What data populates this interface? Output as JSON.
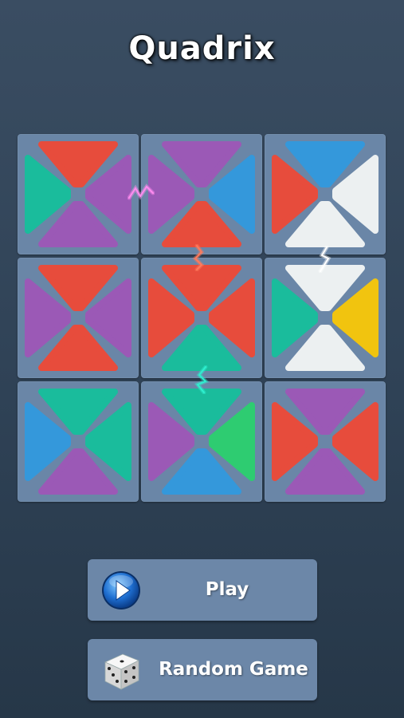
{
  "title": "Quadrix",
  "colors": {
    "red": "#e74c3c",
    "purple": "#9b59b6",
    "blue": "#3498db",
    "green": "#1abc9c",
    "lime": "#2ecc71",
    "white": "#ecf0f1",
    "yellow": "#f1c40f",
    "tile_bg": "#6a86a7"
  },
  "board": {
    "rows": 3,
    "cols": 3,
    "tiles": [
      {
        "top": "red",
        "right": "purple",
        "bottom": "purple",
        "left": "green"
      },
      {
        "top": "purple",
        "right": "blue",
        "bottom": "red",
        "left": "purple"
      },
      {
        "top": "blue",
        "right": "white",
        "bottom": "white",
        "left": "red"
      },
      {
        "top": "red",
        "right": "purple",
        "bottom": "red",
        "left": "purple"
      },
      {
        "top": "red",
        "right": "red",
        "bottom": "green",
        "left": "red"
      },
      {
        "top": "white",
        "right": "yellow",
        "bottom": "white",
        "left": "green"
      },
      {
        "top": "green",
        "right": "green",
        "bottom": "purple",
        "left": "blue"
      },
      {
        "top": "green",
        "right": "lime",
        "bottom": "blue",
        "left": "purple"
      },
      {
        "top": "purple",
        "right": "red",
        "bottom": "purple",
        "left": "red"
      }
    ],
    "sparks": [
      {
        "between": "tile-0-0|tile-0-1",
        "color": "#ff8cf0",
        "icon": "lightning-spark"
      },
      {
        "between": "tile-0-1|tile-1-1",
        "color": "#ff7a5c",
        "icon": "lightning-spark"
      },
      {
        "between": "tile-0-2|tile-1-2",
        "color": "#ffffff",
        "icon": "lightning-spark"
      },
      {
        "between": "tile-1-1|tile-2-1",
        "color": "#2ef0d0",
        "icon": "lightning-spark"
      }
    ]
  },
  "buttons": {
    "play_label": "Play",
    "play_icon": "play-icon",
    "random_label": "Random Game",
    "random_icon": "dice-icon"
  }
}
